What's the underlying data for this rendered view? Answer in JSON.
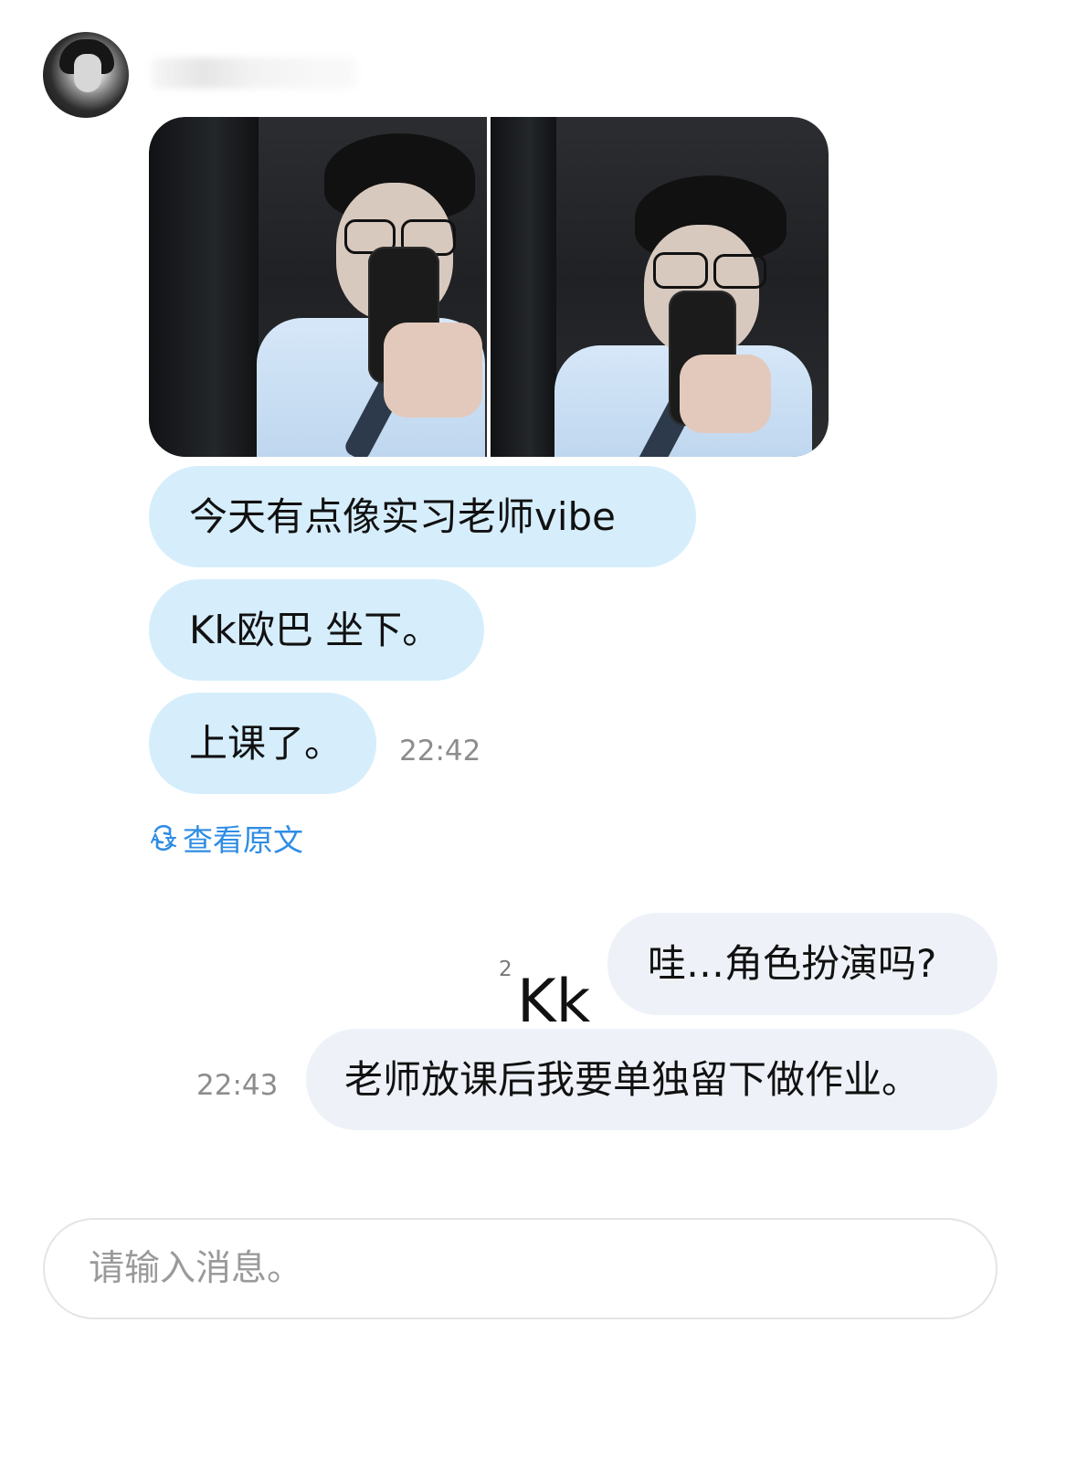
{
  "chat": {
    "incoming": {
      "message_1": "今天有点像实习老师vibe",
      "message_2": "Kk欧巴 坐下。",
      "message_3": "上课了。",
      "time": "22:42",
      "view_original": "查看原文"
    },
    "label": {
      "superscript": "2",
      "name": "Kk"
    },
    "outgoing": {
      "message_1": "哇…角色扮演吗?",
      "message_2": "老师放课后我要单独留下做作业。",
      "time": "22:43"
    }
  },
  "composer": {
    "placeholder": "请输入消息。"
  },
  "icons": {
    "translate": "translate-icon"
  },
  "colors": {
    "incoming_bubble": "#d6eefc",
    "outgoing_bubble": "#eef2f8",
    "link": "#2f8de4",
    "timestamp": "#8d8d8d",
    "input_border": "#e4e4e4"
  }
}
